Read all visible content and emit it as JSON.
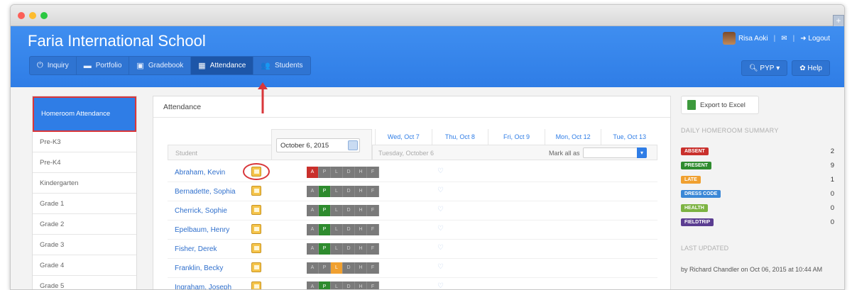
{
  "school_name": "Faria International School",
  "user": {
    "name": "Risa Aoki",
    "logout_label": "Logout",
    "logout_icon": "logout-icon",
    "mail_icon": "mail-icon"
  },
  "nav": [
    {
      "label": "Inquiry",
      "icon": "power-icon"
    },
    {
      "label": "Portfolio",
      "icon": "briefcase-icon"
    },
    {
      "label": "Gradebook",
      "icon": "book-icon"
    },
    {
      "label": "Attendance",
      "icon": "table-icon",
      "active": true
    },
    {
      "label": "Students",
      "icon": "users-icon"
    }
  ],
  "right_buttons": {
    "program_label": "PYP",
    "help_label": "Help"
  },
  "sidebar": [
    {
      "label": "Homeroom Attendance",
      "active": true
    },
    {
      "label": "Pre-K3"
    },
    {
      "label": "Pre-K4"
    },
    {
      "label": "Kindergarten"
    },
    {
      "label": "Grade 1"
    },
    {
      "label": "Grade 2"
    },
    {
      "label": "Grade 3"
    },
    {
      "label": "Grade 4"
    },
    {
      "label": "Grade 5"
    }
  ],
  "main": {
    "title": "Attendance",
    "date_value": "October 6, 2015",
    "student_header": "Student",
    "day_headers": [
      "Wed, Oct 7",
      "Thu, Oct 8",
      "Fri, Oct 9",
      "Mon, Oct 12",
      "Tue, Oct 13"
    ],
    "subheader_date": "Tuesday, October 6",
    "mark_all_label": "Mark all as",
    "code_letters": [
      "A",
      "P",
      "L",
      "D",
      "H",
      "F"
    ],
    "students": [
      {
        "name": "Abraham, Kevin",
        "status": "A"
      },
      {
        "name": "Bernadette, Sophia",
        "status": "P"
      },
      {
        "name": "Cherrick, Sophie",
        "status": "P"
      },
      {
        "name": "Epelbaum, Henry",
        "status": "P"
      },
      {
        "name": "Fisher, Derek",
        "status": "P"
      },
      {
        "name": "Franklin, Becky",
        "status": "L"
      },
      {
        "name": "Ingraham, Joseph",
        "status": "P"
      }
    ]
  },
  "right_panel": {
    "export_label": "Export to Excel",
    "summary_title": "DAILY HOMEROOM SUMMARY",
    "summary": [
      {
        "label": "ABSENT",
        "count": "2",
        "color": "#c9302c"
      },
      {
        "label": "PRESENT",
        "count": "9",
        "color": "#2e8b2e"
      },
      {
        "label": "LATE",
        "count": "1",
        "color": "#f0a030"
      },
      {
        "label": "DRESS CODE",
        "count": "0",
        "color": "#3a87d6"
      },
      {
        "label": "HEALTH",
        "count": "0",
        "color": "#7cb342"
      },
      {
        "label": "FIELDTRIP",
        "count": "0",
        "color": "#5b3d91"
      }
    ],
    "updated_title": "LAST UPDATED",
    "updated_text": "by Richard Chandler on Oct 06, 2015 at 10:44 AM"
  },
  "colors": {
    "brand_blue": "#2f7de6",
    "highlight_red": "#d9363a"
  }
}
